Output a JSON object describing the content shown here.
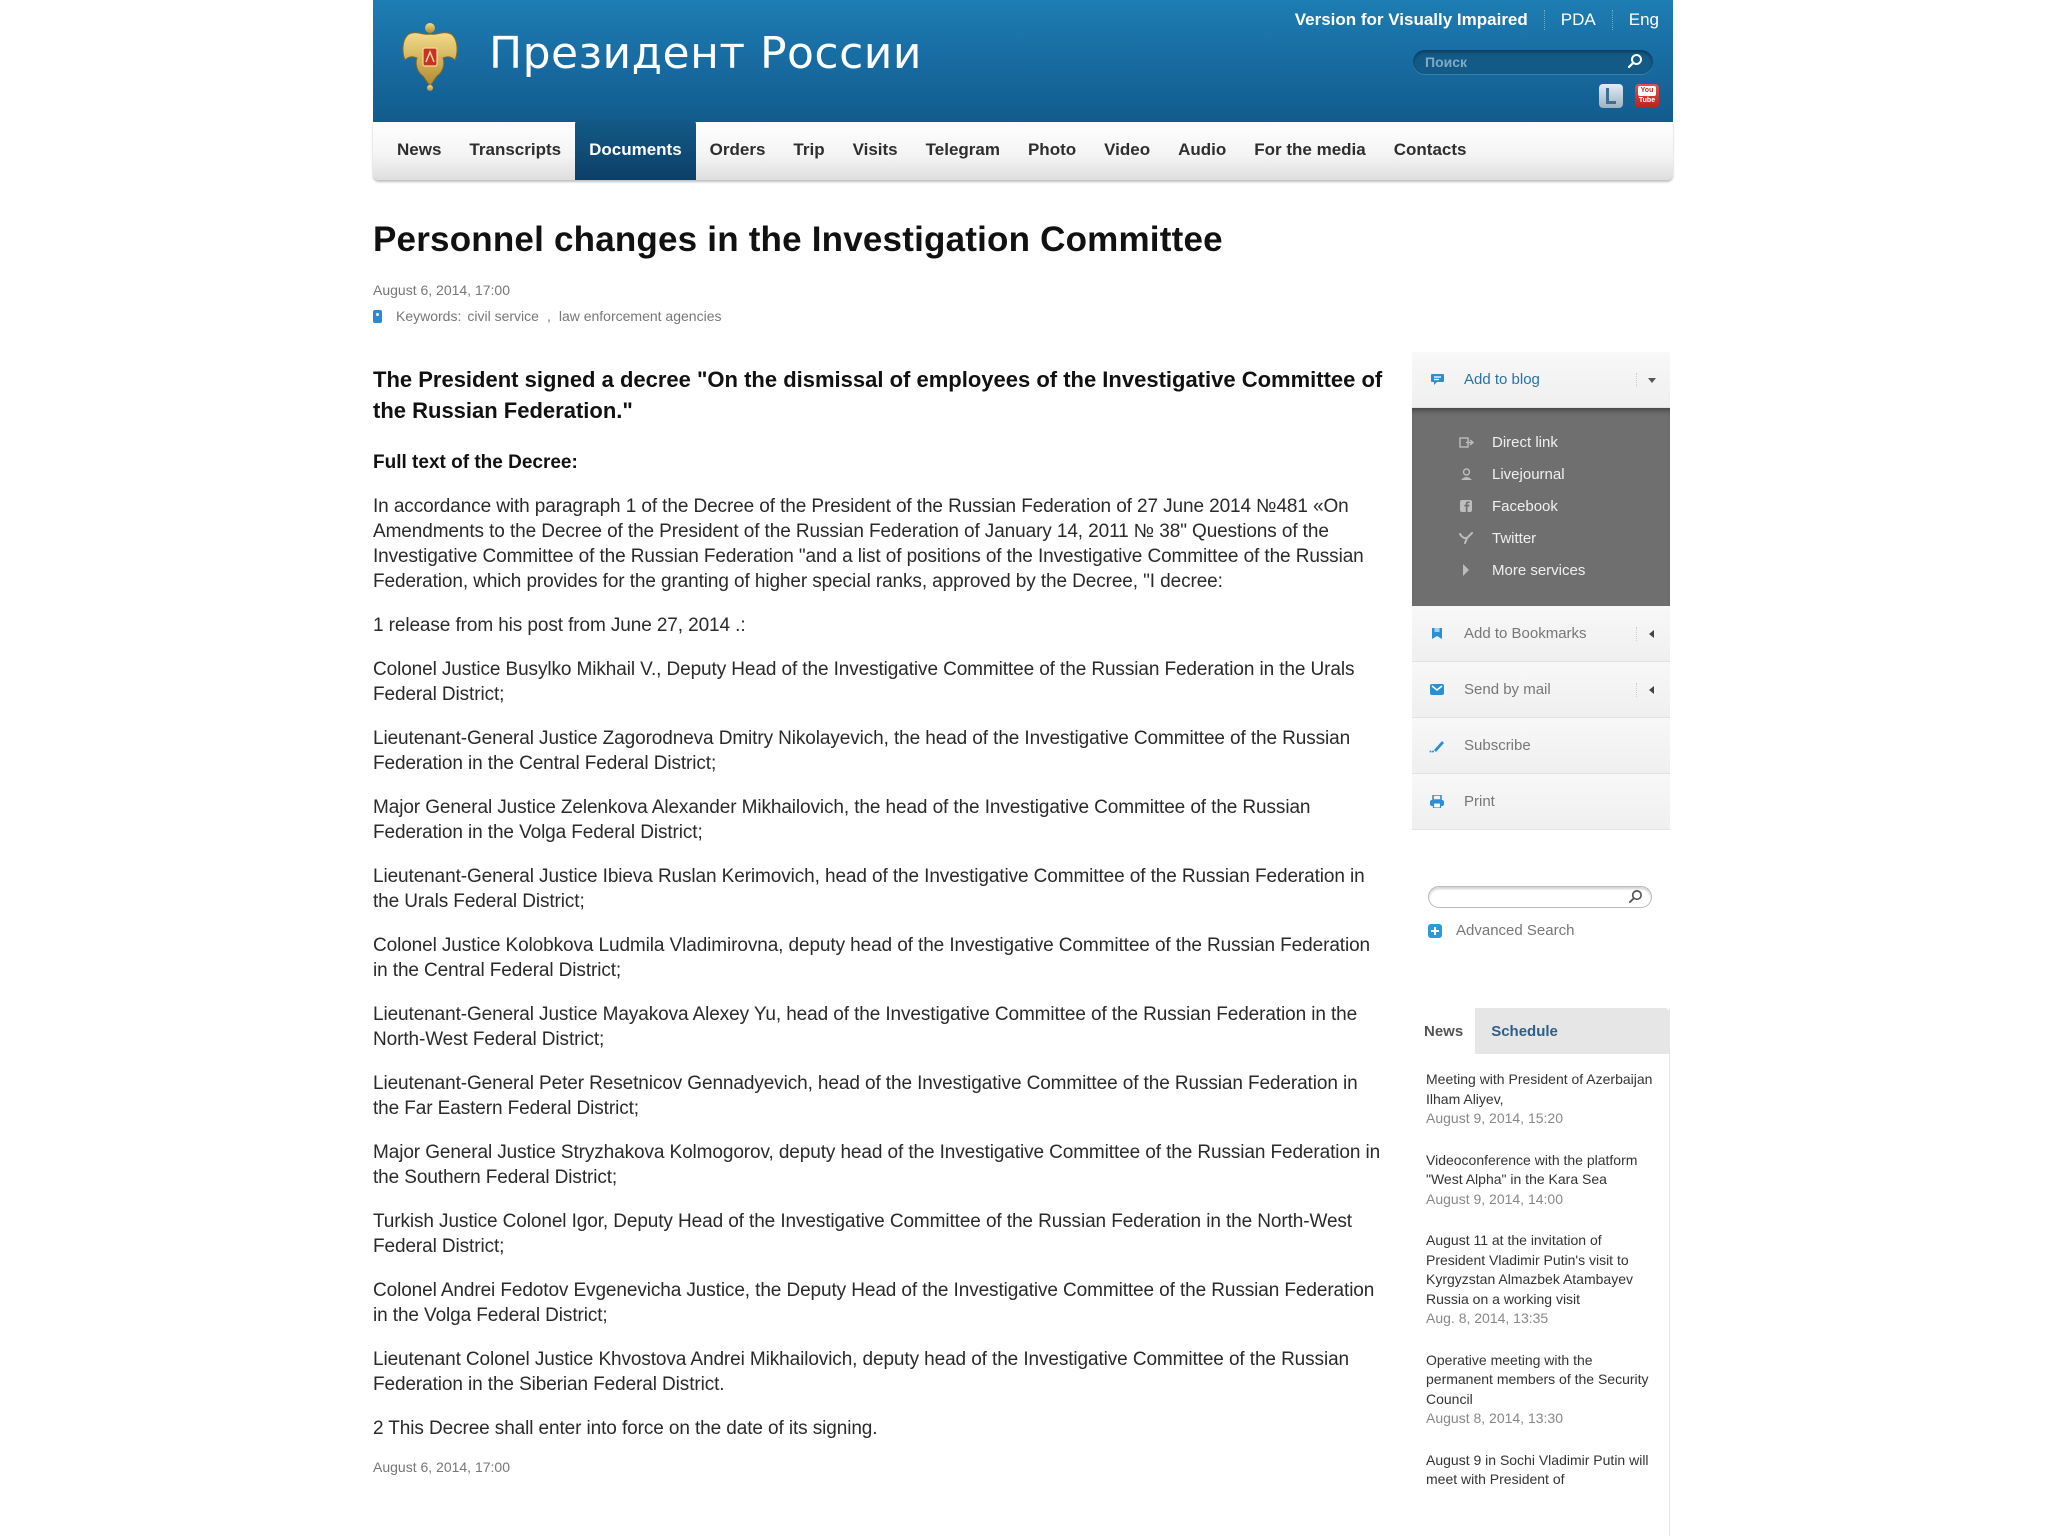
{
  "header": {
    "site_title": "Президент России",
    "top_links": [
      "Version for Visually Impaired",
      "PDA",
      "Eng"
    ],
    "search_placeholder": "Поиск",
    "social": [
      "twitter-icon",
      "youtube-icon"
    ],
    "youtube_label_top": "You",
    "youtube_label_bottom": "Tube"
  },
  "nav": {
    "items": [
      "News",
      "Transcripts",
      "Documents",
      "Orders",
      "Trip",
      "Visits",
      "Telegram",
      "Photo",
      "Video",
      "Audio",
      "For the media",
      "Contacts"
    ],
    "active": "Documents"
  },
  "article": {
    "title": "Personnel changes in the Investigation Committee",
    "date": "August 6, 2014, 17:00",
    "keywords_label": "Keywords:",
    "keywords": [
      "civil service",
      "law enforcement agencies"
    ],
    "keywords_separator": ",",
    "lead": "The President signed a decree \"On the dismissal of employees of the Investigative Committee of the Russian Federation.\"",
    "fulltext_heading": "Full text of the Decree:",
    "paragraphs": [
      "In accordance with paragraph 1 of the Decree of the President of the Russian Federation of 27 June 2014 №481 «On Amendments to the Decree of the President of the Russian Federation of January 14, 2011 № 38\" Questions of the Investigative Committee of the Russian Federation \"and a list of positions of the Investigative Committee of the Russian Federation, which provides for the granting of higher special ranks, approved by the Decree, \"I decree:",
      "1 release from his post from June 27, 2014 .:",
      "Colonel Justice Busylko Mikhail V., Deputy Head of the Investigative Committee of the Russian Federation in the Urals Federal District;",
      "Lieutenant-General Justice Zagorodneva Dmitry Nikolayevich, the head of the Investigative Committee of the Russian Federation in the Central Federal District;",
      "Major General Justice Zelenkova Alexander Mikhailovich, the head of the Investigative Committee of the Russian Federation in the Volga Federal District;",
      "Lieutenant-General Justice Ibieva Ruslan Kerimovich, head of the Investigative Committee of the Russian Federation in the Urals Federal District;",
      "Colonel Justice Kolobkova Ludmila Vladimirovna, deputy head of the Investigative Committee of the Russian Federation in the Central Federal District;",
      "Lieutenant-General Justice Mayakova Alexey Yu, head of the Investigative Committee of the Russian Federation in the North-West Federal District;",
      "Lieutenant-General Peter Resetnicov Gennadyevich, head of the Investigative Committee of the Russian Federation in the Far Eastern Federal District;",
      "Major General Justice Stryzhakova Kolmogorov, deputy head of the Investigative Committee of the Russian Federation in the Southern Federal District;",
      "Turkish Justice Colonel Igor, Deputy Head of the Investigative Committee of the Russian Federation in the North-West Federal District;",
      "Colonel Andrei Fedotov Evgenevicha Justice, the Deputy Head of the Investigative Committee of the Russian Federation in the Volga Federal District;",
      "Lieutenant Colonel Justice Khvostova Andrei Mikhailovich, deputy head of the Investigative Committee of the Russian Federation in the Siberian Federal District.",
      "2 This Decree shall enter into force on the date of its signing."
    ],
    "bottom_date": "August 6, 2014, 17:00"
  },
  "sidebar": {
    "share": {
      "add_to_blog": "Add to blog",
      "dropdown": [
        {
          "label": "Direct link",
          "icon": "direct-link-icon"
        },
        {
          "label": "Livejournal",
          "icon": "livejournal-icon"
        },
        {
          "label": "Facebook",
          "icon": "facebook-icon"
        },
        {
          "label": "Twitter",
          "icon": "twitter-icon"
        },
        {
          "label": "More services",
          "icon": "more-services-icon"
        }
      ],
      "add_to_bookmarks": "Add to Bookmarks",
      "send_by_mail": "Send by mail",
      "subscribe": "Subscribe",
      "print": "Print"
    },
    "search": {
      "value": "",
      "advanced_search": "Advanced Search"
    },
    "news_tabs": [
      "News",
      "Schedule"
    ],
    "news_active_tab": "News",
    "news": [
      {
        "title": "Meeting with President of Azerbaijan Ilham Aliyev,",
        "date": "August 9, 2014, 15:20"
      },
      {
        "title": "Videoconference with the platform \"West Alpha\" in the Kara Sea",
        "date": "August 9, 2014, 14:00"
      },
      {
        "title": "August 11 at the invitation of President Vladimir Putin's visit to Kyrgyzstan Almazbek Atambayev Russia on a working visit",
        "date": "Aug. 8, 2014, 13:35"
      },
      {
        "title": "Operative meeting with the permanent members of the Security Council",
        "date": "August 8, 2014, 13:30"
      },
      {
        "title": "August 9 in Sochi Vladimir Putin will meet with President of",
        "date": ""
      }
    ]
  },
  "colors": {
    "header_blue": "#176aa0",
    "nav_active": "#0d3f66",
    "link_blue": "#2672a8",
    "share_dropdown_bg": "#6f6f6f"
  }
}
